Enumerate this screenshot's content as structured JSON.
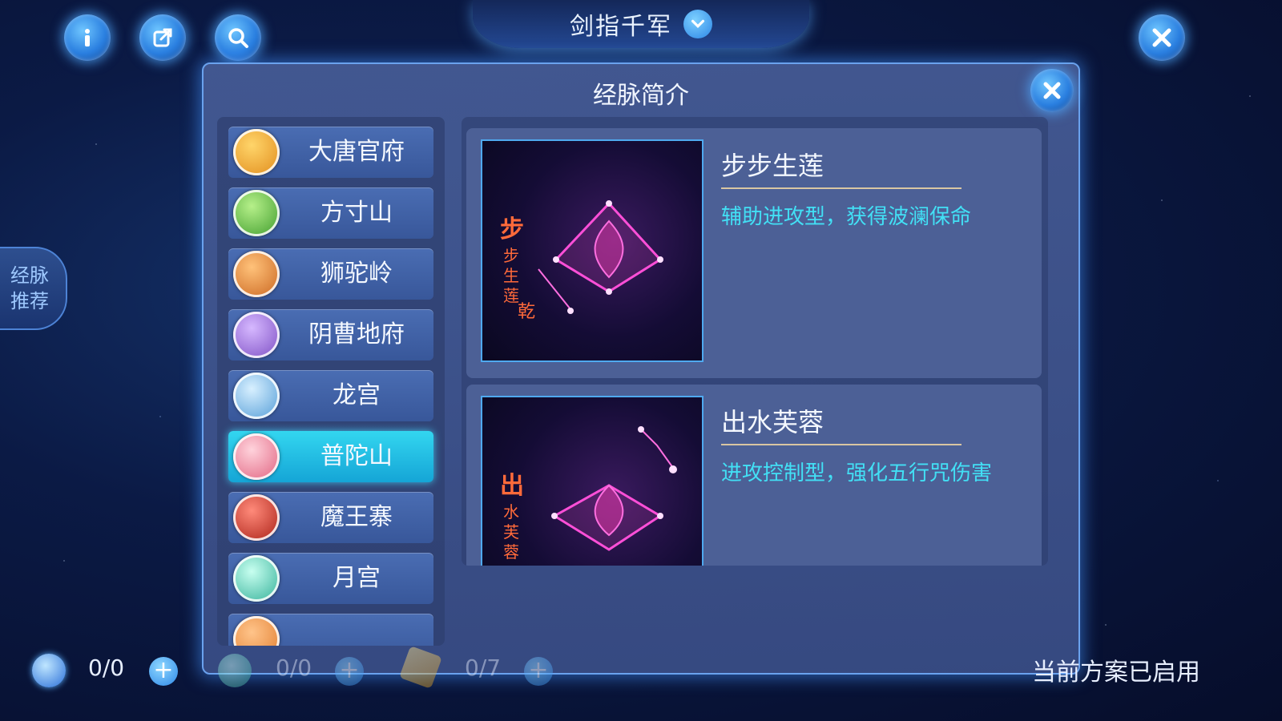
{
  "header": {
    "title": "剑指千军",
    "icons": [
      "info-icon",
      "share-icon",
      "search-icon",
      "close-icon",
      "chevron-down-icon"
    ]
  },
  "side_tab": {
    "label": "经脉\n推荐"
  },
  "panel": {
    "title": "经脉简介",
    "sects": [
      {
        "label": "大唐官府",
        "icon_color": "#f0a030"
      },
      {
        "label": "方寸山",
        "icon_color": "#5cbf3a"
      },
      {
        "label": "狮驼岭",
        "icon_color": "#e6892e"
      },
      {
        "label": "阴曹地府",
        "icon_color": "#9b6ad6"
      },
      {
        "label": "龙宫",
        "icon_color": "#6ab6e8"
      },
      {
        "label": "普陀山",
        "icon_color": "#f07f9a",
        "selected": true
      },
      {
        "label": "魔王寨",
        "icon_color": "#d23a2a"
      },
      {
        "label": "月宫",
        "icon_color": "#4fc8b2"
      },
      {
        "label": "",
        "icon_color": "#f09040"
      }
    ],
    "details": [
      {
        "name": "步步生莲",
        "desc": "辅助进攻型，获得波澜保命",
        "image_text": "步步生莲·乾"
      },
      {
        "name": "出水芙蓉",
        "desc": "进攻控制型，强化五行咒伤害",
        "image_text": "出水芙蓉"
      }
    ]
  },
  "bottom": {
    "resources": [
      {
        "value": "0/0"
      },
      {
        "value": "0/0"
      },
      {
        "value": "0/7"
      }
    ],
    "status": "当前方案已启用"
  },
  "colors": {
    "accent": "#42e0f5",
    "panel_border": "#6aa2ee",
    "selected": "#22bfe6"
  }
}
